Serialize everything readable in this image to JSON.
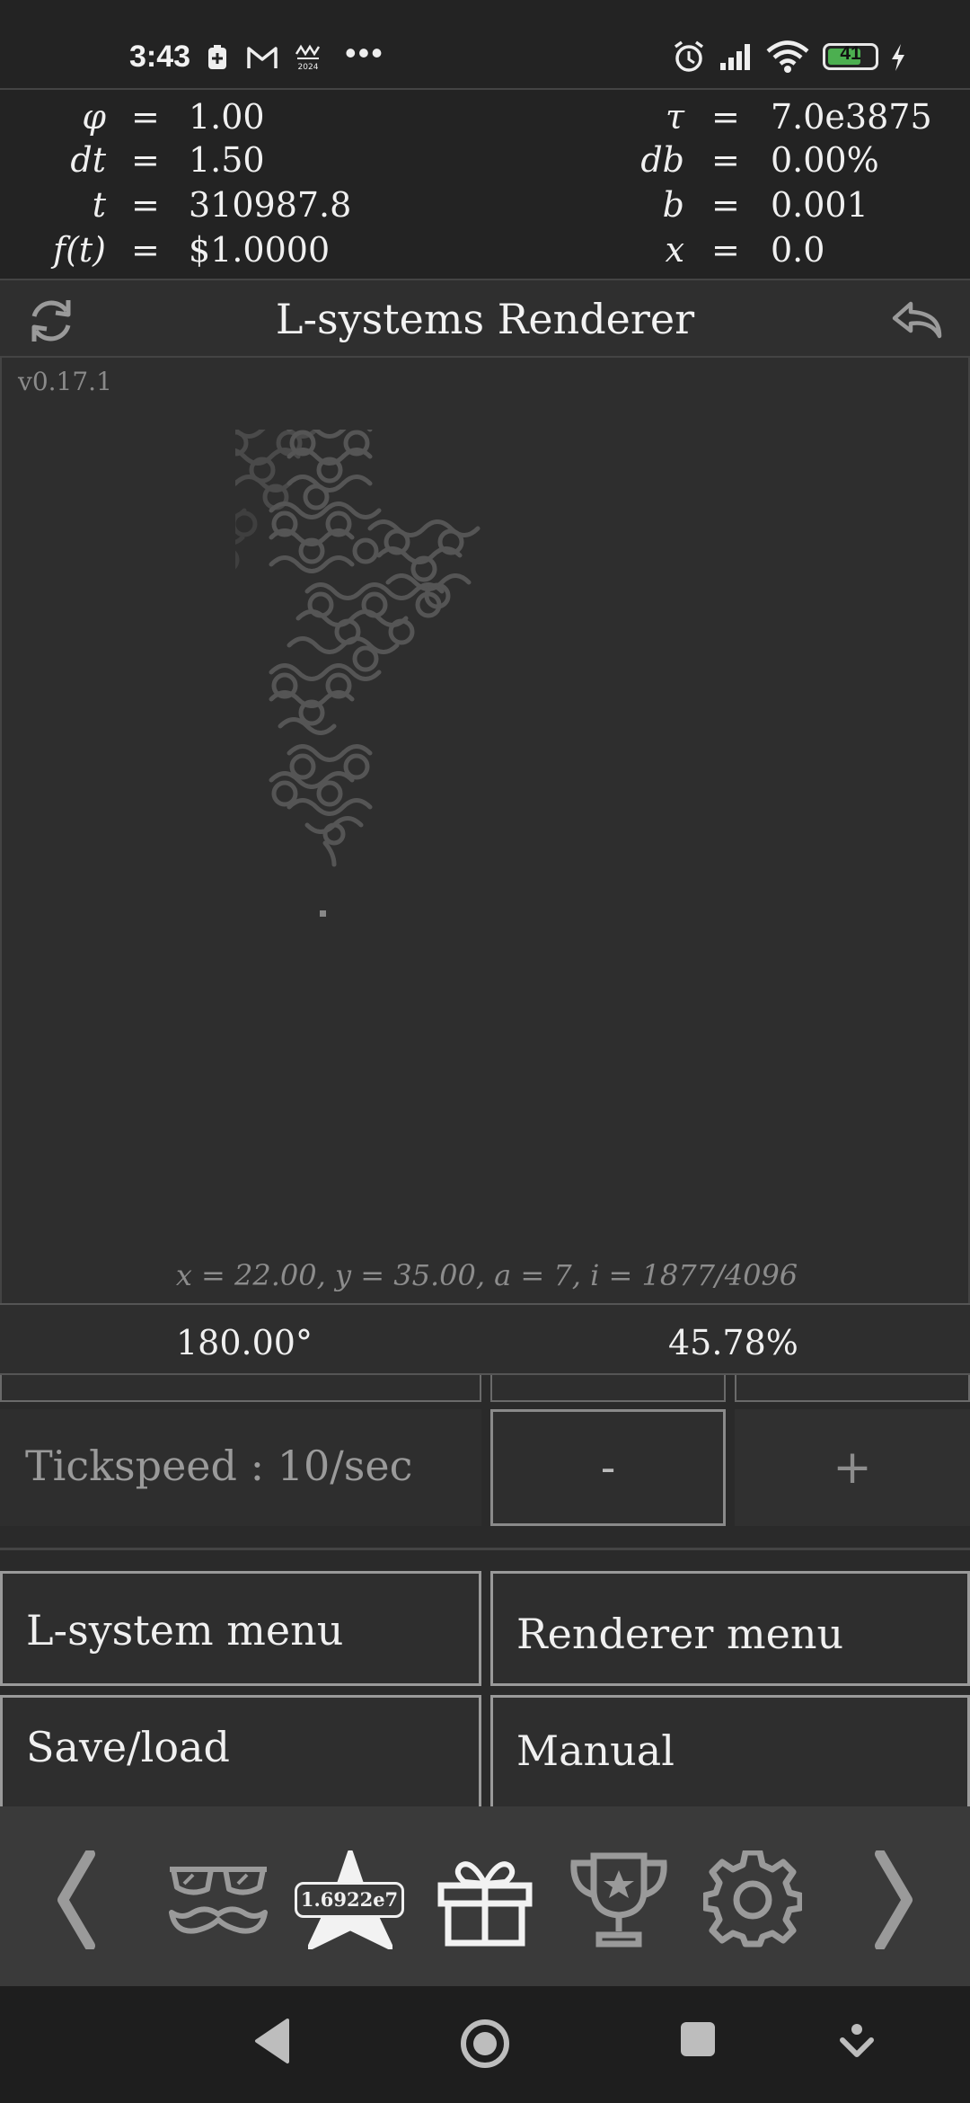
{
  "status_bar": {
    "time": "3:43",
    "battery_level": "41",
    "notification_icons": [
      "battery-saver-icon",
      "gmail-icon",
      "app-2024-icon",
      "more-dots-icon"
    ],
    "system_icons": [
      "alarm-icon",
      "signal-icon",
      "wifi-icon",
      "battery-icon",
      "charging-icon"
    ]
  },
  "equations": {
    "left": [
      {
        "symbol": "φ",
        "equals": "=",
        "value": "1.00"
      },
      {
        "symbol": "dt",
        "equals": "=",
        "value": "1.50"
      },
      {
        "symbol": "t",
        "equals": "=",
        "value": "310987.8"
      },
      {
        "symbol": "f(t)",
        "equals": "=",
        "value": "$1.0000"
      }
    ],
    "right": [
      {
        "symbol": "τ",
        "equals": "=",
        "value": "7.0e3875"
      },
      {
        "symbol": "db",
        "equals": "=",
        "value": "0.00%"
      },
      {
        "symbol": "b",
        "equals": "=",
        "value": "0.001"
      },
      {
        "symbol": "x",
        "equals": "=",
        "value": "0.0"
      }
    ]
  },
  "header": {
    "title": "L-systems Renderer",
    "left_icon": "refresh-icon",
    "right_icon": "undo-arrow-icon"
  },
  "canvas": {
    "version": "v0.17.1",
    "coords_text": "x = 22.00,   y = 35.00,   a = 7,   i = 1877/4096"
  },
  "readout": {
    "angle": "180.00°",
    "progress": "45.78%"
  },
  "tick": {
    "label": "Tickspeed :  10/sec",
    "minus": "-",
    "plus": "+"
  },
  "menu": {
    "lsystem": "L-system menu",
    "renderer": "Renderer menu",
    "saveload": "Save/load",
    "manual": "Manual"
  },
  "tabbar": {
    "star_badge": "1.6922e7",
    "icons": [
      "chevron-left-icon",
      "glasses-mustache-icon",
      "star-icon",
      "gift-icon",
      "trophy-icon",
      "settings-gear-icon",
      "chevron-right-icon"
    ]
  },
  "navbar": {
    "icons": [
      "nav-back-icon",
      "nav-home-icon",
      "nav-recents-icon",
      "nav-extra-icon"
    ]
  }
}
